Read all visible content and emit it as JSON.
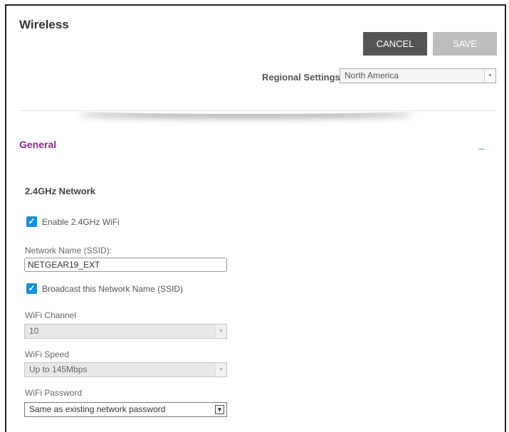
{
  "header": {
    "title": "Wireless",
    "cancel_label": "CANCEL",
    "save_label": "SAVE",
    "regional_label": "Regional Settings:",
    "regional_value": "North America"
  },
  "section": {
    "title": "General",
    "collapse_symbol": "_",
    "subsection_title": "2.4GHz Network"
  },
  "form": {
    "enable_wifi": {
      "label": "Enable 2.4GHz WiFi",
      "checked": true
    },
    "ssid": {
      "label": "Network Name (SSID):",
      "value": "NETGEAR19_EXT"
    },
    "broadcast": {
      "label": "Broadcast this Network Name (SSID)",
      "checked": true
    },
    "channel": {
      "label": "WiFi Channel",
      "value": "10"
    },
    "speed": {
      "label": "WiFi Speed",
      "value": "Up to 145Mbps"
    },
    "password": {
      "label": "WiFi Password",
      "value": "Same as existing network password"
    }
  },
  "icons": {
    "check": "✓",
    "dropdown_arrow": "▼",
    "accent_color": "#1a8fd8",
    "section_color": "#8c2a8c"
  }
}
